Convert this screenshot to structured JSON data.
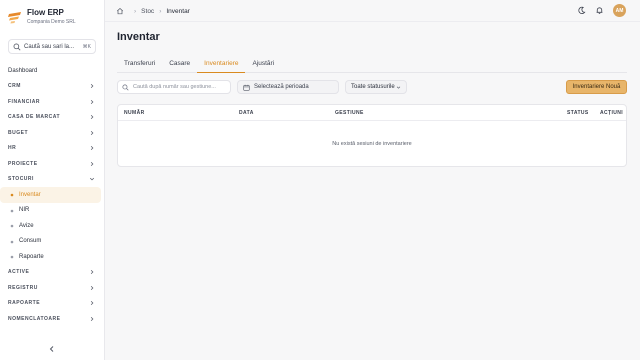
{
  "app": {
    "name": "Flow ERP",
    "company": "Compania Demo SRL"
  },
  "colors": {
    "accent": "#d98a1f",
    "accent_bg": "#fbf3e6",
    "button": "#e8b56a"
  },
  "sidebar": {
    "search": {
      "label": "Caută sau sari la...",
      "shortcut": "⌘K"
    },
    "items": [
      {
        "label": "Dashboard",
        "type": "link",
        "icon": "dashboard-icon"
      },
      {
        "label": "CRM",
        "type": "section",
        "expanded": false
      },
      {
        "label": "FINANCIAR",
        "type": "section",
        "expanded": false
      },
      {
        "label": "CASA DE MARCAT",
        "type": "section",
        "expanded": false
      },
      {
        "label": "BUGET",
        "type": "section",
        "expanded": false
      },
      {
        "label": "HR",
        "type": "section",
        "expanded": false
      },
      {
        "label": "PROIECTE",
        "type": "section",
        "expanded": false
      },
      {
        "label": "STOCURI",
        "type": "section",
        "expanded": true
      },
      {
        "label": "Inventar",
        "type": "sub",
        "active": true
      },
      {
        "label": "NIR",
        "type": "sub"
      },
      {
        "label": "Avize",
        "type": "sub"
      },
      {
        "label": "Consum",
        "type": "sub"
      },
      {
        "label": "Rapoarte",
        "type": "sub"
      },
      {
        "label": "ACTIVE",
        "type": "section",
        "expanded": false
      },
      {
        "label": "REGISTRU",
        "type": "section",
        "expanded": false
      },
      {
        "label": "RAPOARTE",
        "type": "section",
        "expanded": false
      },
      {
        "label": "NOMENCLATOARE",
        "type": "section",
        "expanded": false
      }
    ]
  },
  "header": {
    "breadcrumb": [
      "Stoc",
      "Inventar"
    ],
    "avatar_initials": "AM"
  },
  "main": {
    "title": "Inventar",
    "tabs": [
      {
        "label": "Transferuri",
        "active": false
      },
      {
        "label": "Casare",
        "active": false
      },
      {
        "label": "Inventariere",
        "active": true
      },
      {
        "label": "Ajustări",
        "active": false
      }
    ],
    "filters": {
      "search_placeholder": "Caută după număr sau gestiune...",
      "date_label": "Selectează perioada",
      "status_label": "Toate statusurile"
    },
    "new_button": "Inventariere Nouă",
    "table": {
      "columns": [
        "NUMĂR",
        "DATA",
        "GESTIUNE",
        "STATUS",
        "ACȚIUNI"
      ],
      "empty_text": "Nu există sesiuni de inventariere"
    }
  }
}
